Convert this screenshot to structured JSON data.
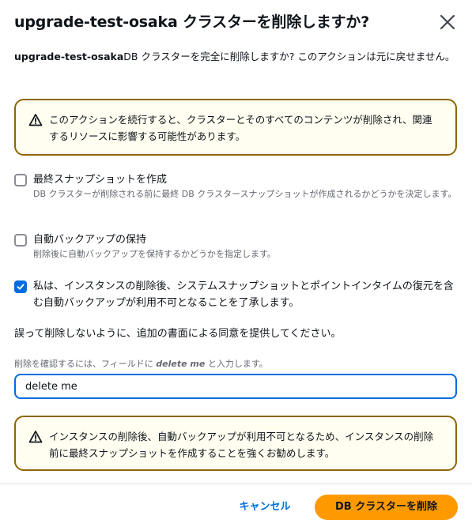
{
  "dialog": {
    "title": "upgrade-test-osaka クラスターを削除しますか?",
    "close_icon": "close-icon",
    "intro_cluster": "upgrade-test-osaka",
    "intro_text": "DB クラスターを完全に削除しますか? このアクションは元に戻せません。"
  },
  "alerts": {
    "warning_1": "このアクションを続行すると、クラスターとそのすべてのコンテンツが削除され、関連するリソースに影響する可能性があります。",
    "warning_2": "インスタンスの削除後、自動バックアップが利用不可となるため、インスタンスの削除前に最終スナップショットを作成することを強くお勧めします。",
    "icon": "warning-icon"
  },
  "options": {
    "final_snapshot": {
      "label": "最終スナップショットを作成",
      "description": "DB クラスターが削除される前に最終 DB クラスタースナップショットが作成されるかどうかを決定します。",
      "checked": false
    },
    "retain_backups": {
      "label": "自動バックアップの保持",
      "description": "削除後に自動バックアップを保持するかどうかを指定します。",
      "checked": false
    },
    "acknowledge": {
      "label": "私は、インスタンスの削除後、システムスナップショットとポイントインタイムの復元を含む自動バックアップが利用不可となることを了承します。",
      "checked": true
    }
  },
  "confirmation": {
    "consent_text": "誤って削除しないように、追加の書面による同意を提供してください。",
    "label_prefix": "削除を確認するには、フィールドに ",
    "label_keyword": "delete me",
    "label_suffix": " と入力します。",
    "input_value": "delete me"
  },
  "footer": {
    "cancel_label": "キャンセル",
    "delete_label": "DB クラスターを削除"
  },
  "colors": {
    "primary": "#006ce0",
    "warning_border": "#8d6605",
    "delete_button": "#ff9900"
  }
}
